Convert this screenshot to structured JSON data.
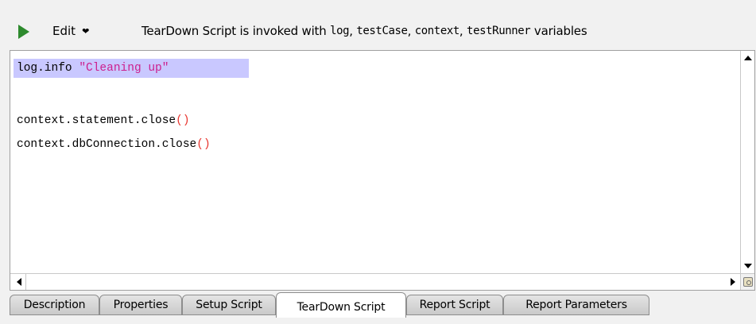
{
  "toolbar": {
    "run_icon": "play-icon",
    "run_color": "#2d8a2d",
    "edit_label": "Edit",
    "info_prefix": "TearDown Script is invoked with ",
    "info_vars": [
      "log",
      "testCase",
      "context",
      "testRunner"
    ],
    "info_sep": ", ",
    "info_suffix": " variables"
  },
  "editor": {
    "lines": [
      {
        "parts": [
          {
            "text": "log.info ",
            "kind": "plain"
          },
          {
            "text": "\"Cleaning up\"",
            "kind": "string"
          }
        ],
        "highlighted": true
      },
      {
        "parts": []
      },
      {
        "parts": [
          {
            "text": "context.statement.close",
            "kind": "plain"
          },
          {
            "text": "()",
            "kind": "paren"
          }
        ]
      },
      {
        "parts": [
          {
            "text": "context.dbConnection.close",
            "kind": "plain"
          },
          {
            "text": "()",
            "kind": "paren"
          }
        ]
      }
    ],
    "highlight_color": "#c9c8ff",
    "string_color": "#cc1f8e",
    "paren_color": "#e8362f"
  },
  "tabs": [
    {
      "label": "Description",
      "active": false
    },
    {
      "label": "Properties",
      "active": false
    },
    {
      "label": "Setup Script",
      "active": false
    },
    {
      "label": "TearDown Script",
      "active": true
    },
    {
      "label": "Report Script",
      "active": false
    },
    {
      "label": "Report Parameters",
      "active": false
    }
  ]
}
